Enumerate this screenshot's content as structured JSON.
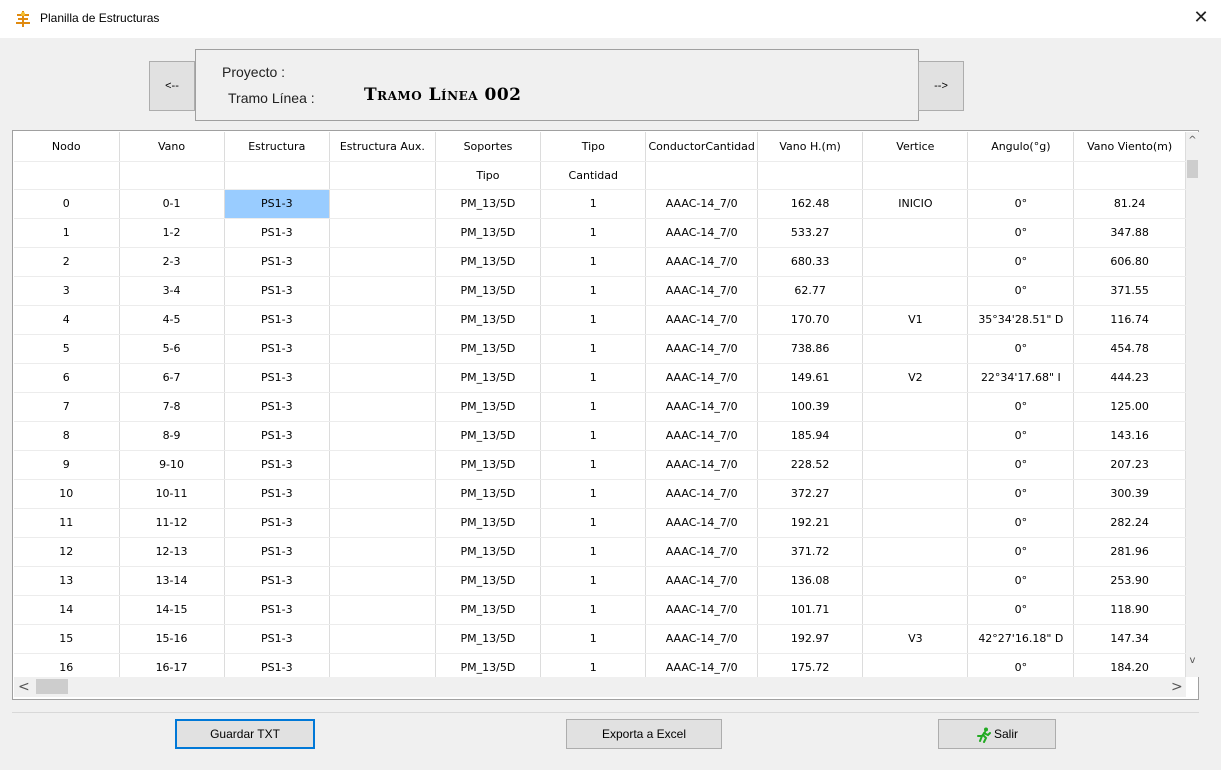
{
  "window": {
    "title": "Planilla de Estructuras",
    "close_glyph": "✕",
    "app_icon": "structure-app-icon"
  },
  "nav": {
    "prev_label": "<--",
    "next_label": "-->"
  },
  "project": {
    "project_label": "Proyecto :",
    "tramo_label": "Tramo Línea :",
    "tramo_value": "Tramo Línea 002"
  },
  "table": {
    "headers": [
      "Nodo",
      "Vano",
      "Estructura",
      "Estructura Aux.",
      "Soportes",
      "Tipo",
      "ConductorCantidad",
      "Vano H.(m)",
      "Vertice",
      "Angulo(°g)",
      "Vano Viento(m)"
    ],
    "subheaders": [
      "",
      "",
      "",
      "",
      "Tipo",
      "Cantidad",
      "",
      "",
      "",
      "",
      ""
    ],
    "rows": [
      [
        "0",
        "0-1",
        "PS1-3",
        "",
        "PM_13/5D",
        "1",
        "AAAC-14_7/0",
        "162.48",
        "INICIO",
        "0°",
        "81.24"
      ],
      [
        "1",
        "1-2",
        "PS1-3",
        "",
        "PM_13/5D",
        "1",
        "AAAC-14_7/0",
        "533.27",
        "",
        "0°",
        "347.88"
      ],
      [
        "2",
        "2-3",
        "PS1-3",
        "",
        "PM_13/5D",
        "1",
        "AAAC-14_7/0",
        "680.33",
        "",
        "0°",
        "606.80"
      ],
      [
        "3",
        "3-4",
        "PS1-3",
        "",
        "PM_13/5D",
        "1",
        "AAAC-14_7/0",
        "62.77",
        "",
        "0°",
        "371.55"
      ],
      [
        "4",
        "4-5",
        "PS1-3",
        "",
        "PM_13/5D",
        "1",
        "AAAC-14_7/0",
        "170.70",
        "V1",
        "35°34'28.51\" D",
        "116.74"
      ],
      [
        "5",
        "5-6",
        "PS1-3",
        "",
        "PM_13/5D",
        "1",
        "AAAC-14_7/0",
        "738.86",
        "",
        "0°",
        "454.78"
      ],
      [
        "6",
        "6-7",
        "PS1-3",
        "",
        "PM_13/5D",
        "1",
        "AAAC-14_7/0",
        "149.61",
        "V2",
        "22°34'17.68\" I",
        "444.23"
      ],
      [
        "7",
        "7-8",
        "PS1-3",
        "",
        "PM_13/5D",
        "1",
        "AAAC-14_7/0",
        "100.39",
        "",
        "0°",
        "125.00"
      ],
      [
        "8",
        "8-9",
        "PS1-3",
        "",
        "PM_13/5D",
        "1",
        "AAAC-14_7/0",
        "185.94",
        "",
        "0°",
        "143.16"
      ],
      [
        "9",
        "9-10",
        "PS1-3",
        "",
        "PM_13/5D",
        "1",
        "AAAC-14_7/0",
        "228.52",
        "",
        "0°",
        "207.23"
      ],
      [
        "10",
        "10-11",
        "PS1-3",
        "",
        "PM_13/5D",
        "1",
        "AAAC-14_7/0",
        "372.27",
        "",
        "0°",
        "300.39"
      ],
      [
        "11",
        "11-12",
        "PS1-3",
        "",
        "PM_13/5D",
        "1",
        "AAAC-14_7/0",
        "192.21",
        "",
        "0°",
        "282.24"
      ],
      [
        "12",
        "12-13",
        "PS1-3",
        "",
        "PM_13/5D",
        "1",
        "AAAC-14_7/0",
        "371.72",
        "",
        "0°",
        "281.96"
      ],
      [
        "13",
        "13-14",
        "PS1-3",
        "",
        "PM_13/5D",
        "1",
        "AAAC-14_7/0",
        "136.08",
        "",
        "0°",
        "253.90"
      ],
      [
        "14",
        "14-15",
        "PS1-3",
        "",
        "PM_13/5D",
        "1",
        "AAAC-14_7/0",
        "101.71",
        "",
        "0°",
        "118.90"
      ],
      [
        "15",
        "15-16",
        "PS1-3",
        "",
        "PM_13/5D",
        "1",
        "AAAC-14_7/0",
        "192.97",
        "V3",
        "42°27'16.18\" D",
        "147.34"
      ],
      [
        "16",
        "16-17",
        "PS1-3",
        "",
        "PM_13/5D",
        "1",
        "AAAC-14_7/0",
        "175.72",
        "",
        "0°",
        "184.20"
      ]
    ],
    "selected_row": 0,
    "selected_col": 2,
    "selected_color": "#99ccff"
  },
  "scroll": {
    "up": "^",
    "down": "v",
    "left": "<",
    "right": ">"
  },
  "buttons": {
    "guardar": "Guardar TXT",
    "exporta": "Exporta a Excel",
    "salir": "Salir",
    "salir_icon": "running-man-icon"
  },
  "colors": {
    "focus_border": "#0078d7",
    "exit_icon": "#22aa22",
    "app_icon": "#f0a020"
  }
}
